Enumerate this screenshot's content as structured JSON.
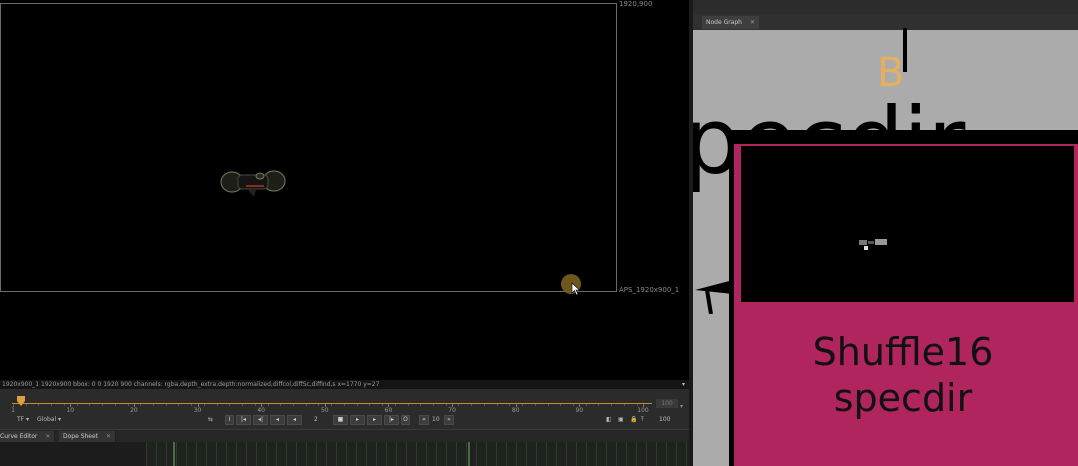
{
  "viewer": {
    "format_top_right": "1920,900",
    "format_bottom_right": "APS_1920x900_1",
    "info_bar": "1920x900_1  1920x900  bbox: 0 0 1920 900 channels: rgba,depth_extra,depth:normalized,diffcol,diffSc,diffind,s  x=1770  y=27"
  },
  "timeline": {
    "ticks": [
      "1",
      "10",
      "20",
      "30",
      "40",
      "50",
      "60",
      "70",
      "80",
      "90",
      "100"
    ],
    "end_frame": "100",
    "controls": {
      "tf": "TF",
      "global": "Global",
      "frame": "2",
      "increment": "10",
      "fps": "100"
    }
  },
  "bottom_tabs": [
    {
      "label": "Curve Editor",
      "close": "✕"
    },
    {
      "label": "Dope Sheet",
      "close": "✕"
    }
  ],
  "node_graph": {
    "tab_label": "Node Graph",
    "tab_close": "✕",
    "background_text": "pecdir",
    "input_label": "B",
    "node": {
      "title_line1": "Shuffle16",
      "title_line2": "specdir"
    },
    "colors": {
      "canvas": "#ababab",
      "node_fill": "#b0255e",
      "input_label": "#e4b060"
    }
  }
}
